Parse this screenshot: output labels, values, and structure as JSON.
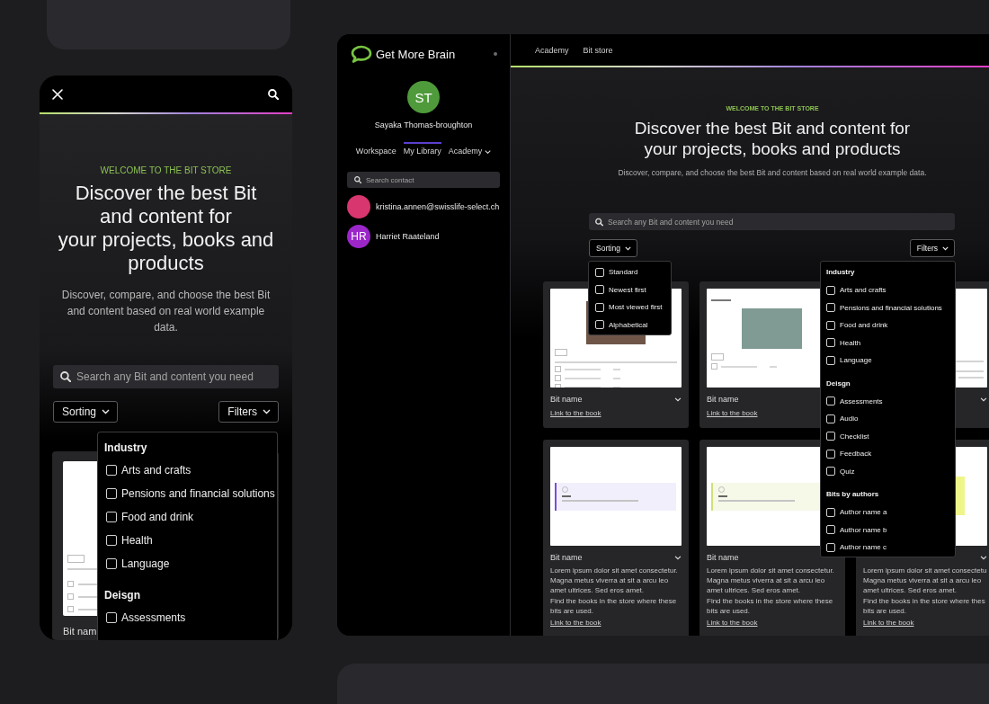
{
  "mobile": {
    "eyebrow": "WELCOME TO THE BIT STORE",
    "title_lines": [
      "Discover the best Bit",
      "and content for",
      "your projects, books and",
      "products"
    ],
    "intro": "Discover, compare, and choose the best Bit and content based on real world example data.",
    "search": {
      "placeholder": "Search any Bit and content you need"
    },
    "sorting": {
      "label": "Sorting"
    },
    "filters": {
      "label": "Filters",
      "groups": [
        {
          "heading": "Industry",
          "options": [
            {
              "label": "Arts and crafts",
              "checked": false
            },
            {
              "label": "Pensions and financial solutions",
              "checked": false
            },
            {
              "label": "Food and drink",
              "checked": false
            },
            {
              "label": "Health",
              "checked": false
            },
            {
              "label": "Language",
              "checked": false
            }
          ]
        },
        {
          "heading": "Deisgn",
          "options": [
            {
              "label": "Assessments",
              "checked": false
            }
          ]
        }
      ]
    },
    "cards": [
      {
        "kind": "quiz",
        "title": "Bit nam"
      }
    ]
  },
  "desktop": {
    "sidebar": {
      "brand": "Get More Brain",
      "user": {
        "initials": "ST",
        "name": "Sayaka Thomas-broughton"
      },
      "tabs": [
        {
          "label": "Workspace",
          "selected": false,
          "kind": "tab"
        },
        {
          "label": "My Library",
          "selected": true,
          "kind": "tab"
        },
        {
          "label": "Academy",
          "selected": false,
          "kind": "menu"
        }
      ],
      "search": {
        "placeholder": "Search contact"
      },
      "contacts": [
        {
          "name": "kristina.annen@swisslife-select.ch",
          "color": "#d8366e"
        },
        {
          "name": "Harriet Raateland",
          "initials": "HR",
          "color": "#9b27c9"
        }
      ]
    },
    "nav": [
      {
        "label": "Academy"
      },
      {
        "label": "Bit store"
      }
    ],
    "eyebrow": "WELCOME TO THE BIT STORE",
    "title_lines": [
      "Discover the best Bit and content for",
      "your projects, books and products"
    ],
    "intro": "Discover, compare, and choose the best Bit and content based on real world example data.",
    "search": {
      "placeholder": "Search any Bit and content you need"
    },
    "sorting": {
      "label": "Sorting",
      "options": [
        {
          "label": "Standard",
          "checked": false
        },
        {
          "label": "Newest first",
          "checked": false
        },
        {
          "label": "Most viewed first",
          "checked": false
        },
        {
          "label": "Alphabetical",
          "checked": false
        }
      ]
    },
    "filters": {
      "label": "Filters",
      "groups": [
        {
          "heading": "Industry",
          "options": [
            {
              "label": "Arts and crafts",
              "checked": false
            },
            {
              "label": "Pensions and financial solutions",
              "checked": false
            },
            {
              "label": "Food and drink",
              "checked": false
            },
            {
              "label": "Health",
              "checked": false
            },
            {
              "label": "Language",
              "checked": false
            }
          ]
        },
        {
          "heading": "Deisgn",
          "options": [
            {
              "label": "Assessments",
              "checked": false
            },
            {
              "label": "Audio",
              "checked": false
            },
            {
              "label": "Checklist",
              "checked": false
            },
            {
              "label": "Feedback",
              "checked": false
            },
            {
              "label": "Quiz",
              "checked": false
            }
          ]
        },
        {
          "heading": "Bits by authors",
          "options": [
            {
              "label": "Author name a",
              "checked": false
            },
            {
              "label": "Author name b",
              "checked": false
            },
            {
              "label": "Author name c",
              "checked": false
            }
          ]
        }
      ]
    },
    "cards": [
      {
        "kind": "quiz",
        "title": "Bit name",
        "toggle": true,
        "link": "Link to the book"
      },
      {
        "kind": "recipe",
        "title": "Bit name",
        "link": "Link to the book"
      },
      {
        "kind": "text",
        "toggle": true
      },
      {
        "kind": "info-note",
        "title": "Bit name",
        "toggle": true,
        "description_lines": [
          "Lorem ipsum dolor sit amet consectetur.",
          "Magna metus viverra at sit a arcu leo",
          "amet ultrices. Sed eros amet."
        ],
        "note_lines": [
          "Find the books in the store where these",
          "bits are used."
        ],
        "link": "Link to the book"
      },
      {
        "kind": "hint-note",
        "title": "Bit name",
        "description_lines": [
          "Lorem ipsum dolor sit amet consectetur.",
          "Magna metus viverra at sit a arcu leo",
          "amet ultrices. Sed eros amet."
        ],
        "note_lines": [
          "Find the books in the store where these",
          "bits are used."
        ],
        "link": "Link to the book"
      },
      {
        "kind": "highlight",
        "toggle": true,
        "description_lines": [
          "Lorem ipsum dolor sit amet consectetu",
          "Magna metus viverra at sit a arcu leo",
          "amet ultrices. Sed eros amet."
        ],
        "note_lines": [
          "Find the books in the store where thes",
          "bits are used."
        ],
        "link": "Link to the book"
      }
    ]
  }
}
